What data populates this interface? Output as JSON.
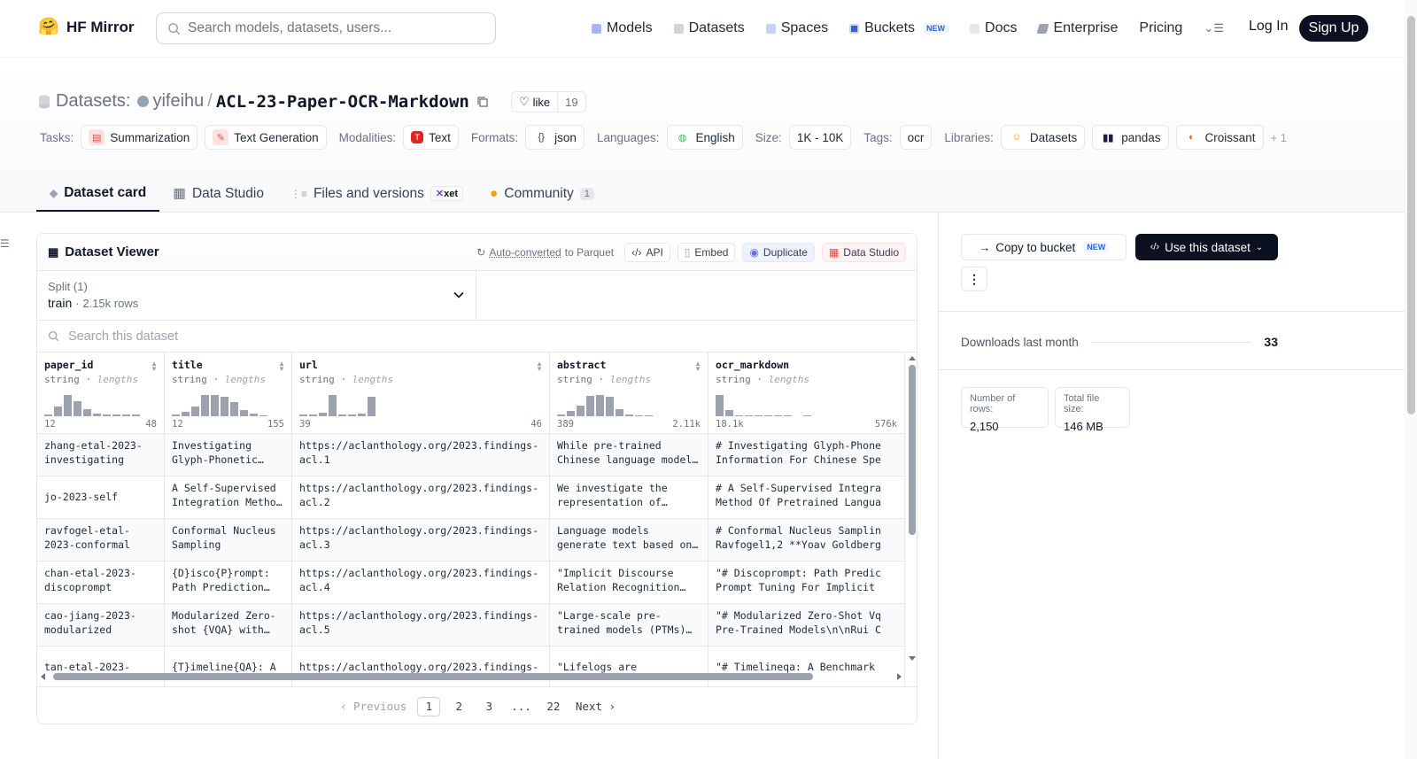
{
  "header": {
    "logo_text": "HF Mirror",
    "search_placeholder": "Search models, datasets, users...",
    "nav": [
      {
        "label": "Models",
        "icon": "models-icon"
      },
      {
        "label": "Datasets",
        "icon": "datasets-icon"
      },
      {
        "label": "Spaces",
        "icon": "spaces-icon"
      },
      {
        "label": "Buckets",
        "icon": "buckets-icon",
        "badge": "NEW"
      },
      {
        "label": "Docs",
        "icon": "docs-icon"
      },
      {
        "label": "Enterprise",
        "icon": "enterprise-icon"
      },
      {
        "label": "Pricing"
      }
    ],
    "login": "Log In",
    "signup": "Sign Up"
  },
  "breadcrumb": {
    "section": "Datasets:",
    "user": "yifeihu",
    "separator": "/",
    "name": "ACL-23-Paper-OCR-Markdown",
    "like_label": "like",
    "like_count": "19"
  },
  "tags": {
    "tasks_label": "Tasks:",
    "tasks": [
      "Summarization",
      "Text Generation"
    ],
    "modalities_label": "Modalities:",
    "modalities": [
      "Text"
    ],
    "formats_label": "Formats:",
    "formats": [
      "json"
    ],
    "languages_label": "Languages:",
    "languages": [
      "English"
    ],
    "size_label": "Size:",
    "size": "1K - 10K",
    "tags_label": "Tags:",
    "tags": [
      "ocr"
    ],
    "libraries_label": "Libraries:",
    "libraries": [
      "Datasets",
      "pandas",
      "Croissant"
    ],
    "more": "+ 1"
  },
  "tabs": [
    {
      "label": "Dataset card",
      "active": true
    },
    {
      "label": "Data Studio"
    },
    {
      "label": "Files and versions",
      "badge": "xet"
    },
    {
      "label": "Community",
      "count": "1"
    }
  ],
  "viewer": {
    "title": "Dataset Viewer",
    "auto_converted": "Auto-converted",
    "to_parquet": "to Parquet",
    "actions": [
      "API",
      "Embed",
      "Duplicate",
      "Data Studio"
    ],
    "split_label": "Split (1)",
    "split_value": "train",
    "split_dot": "·",
    "split_rows": "2.15k rows",
    "search_placeholder": "Search this dataset",
    "columns": [
      {
        "name": "paper_id",
        "type": "string",
        "stat": "lengths",
        "min": "12",
        "max": "48",
        "hist": [
          0.1,
          0.45,
          1.0,
          0.7,
          0.35,
          0.12,
          0.08,
          0.08,
          0.08,
          0.08
        ]
      },
      {
        "name": "title",
        "type": "string",
        "stat": "lengths",
        "min": "12",
        "max": "155",
        "hist": [
          0.08,
          0.2,
          0.45,
          1.0,
          1.0,
          0.9,
          0.65,
          0.3,
          0.12,
          0.06
        ]
      },
      {
        "name": "url",
        "type": "string",
        "stat": "lengths",
        "min": "39",
        "max": "46",
        "hist": [
          0.08,
          0.08,
          0.15,
          1.0,
          0.08,
          0.08,
          0.12,
          0.9
        ]
      },
      {
        "name": "abstract",
        "type": "string",
        "stat": "lengths",
        "min": "389",
        "max": "2.11k",
        "hist": [
          0.1,
          0.25,
          0.5,
          0.95,
          1.0,
          0.9,
          0.35,
          0.1,
          0.06,
          0.06
        ]
      },
      {
        "name": "ocr_markdown",
        "type": "string",
        "stat": "lengths",
        "min": "18.1k",
        "max": "576k",
        "hist": [
          1.0,
          0.3,
          0.06,
          0.06,
          0.06,
          0.06,
          0.06,
          0.06,
          0.0,
          0.06
        ]
      }
    ],
    "rows": [
      [
        "zhang-etal-2023-\ninvestigating",
        "Investigating\nGlyph-Phonetic…",
        "https://aclanthology.org/2023.findings-\nacl.1",
        "While pre-trained\nChinese language model…",
        "# Investigating Glyph-Phone\nInformation For Chinese Spe"
      ],
      [
        "jo-2023-self",
        "A Self-Supervised\nIntegration Metho…",
        "https://aclanthology.org/2023.findings-\nacl.2",
        "We investigate the\nrepresentation of…",
        "# A Self-Supervised Integra\nMethod Of Pretrained Langua"
      ],
      [
        "ravfogel-etal-\n2023-conformal",
        "Conformal Nucleus\nSampling",
        "https://aclanthology.org/2023.findings-\nacl.3",
        "Language models\ngenerate text based on…",
        "# Conformal Nucleus Samplin\nRavfogel1,2 **Yoav Goldberg"
      ],
      [
        "chan-etal-2023-\ndiscoprompt",
        "{D}isco{P}rompt:\nPath Prediction…",
        "https://aclanthology.org/2023.findings-\nacl.4",
        "\"Implicit Discourse\nRelation Recognition…",
        "\"# Discoprompt: Path Predic\nPrompt Tuning For Implicit"
      ],
      [
        "cao-jiang-2023-\nmodularized",
        "Modularized Zero-\nshot {VQA} with…",
        "https://aclanthology.org/2023.findings-\nacl.5",
        "\"Large-scale pre-\ntrained models (PTMs)…",
        "\"# Modularized Zero-Shot Vq\nPre-Trained Models\\n\\nRui C"
      ],
      [
        "tan-etal-2023-",
        "{T}imeline{QA}: A",
        "https://aclanthology.org/2023.findings-",
        "\"Lifelogs are",
        "\"# Timelineqa: A Benchmark"
      ]
    ],
    "pagination": {
      "prev": "Previous",
      "pages": [
        "1",
        "2",
        "3",
        "...",
        "22"
      ],
      "current": "1",
      "next": "Next"
    }
  },
  "sidebar": {
    "copy_to_bucket": "Copy to bucket",
    "copy_badge": "NEW",
    "use_dataset": "Use this dataset",
    "downloads_label": "Downloads last month",
    "downloads_value": "33",
    "rows_label": "Number of rows:",
    "rows_value": "2,150",
    "size_label": "Total file size:",
    "size_value": "146 MB"
  }
}
